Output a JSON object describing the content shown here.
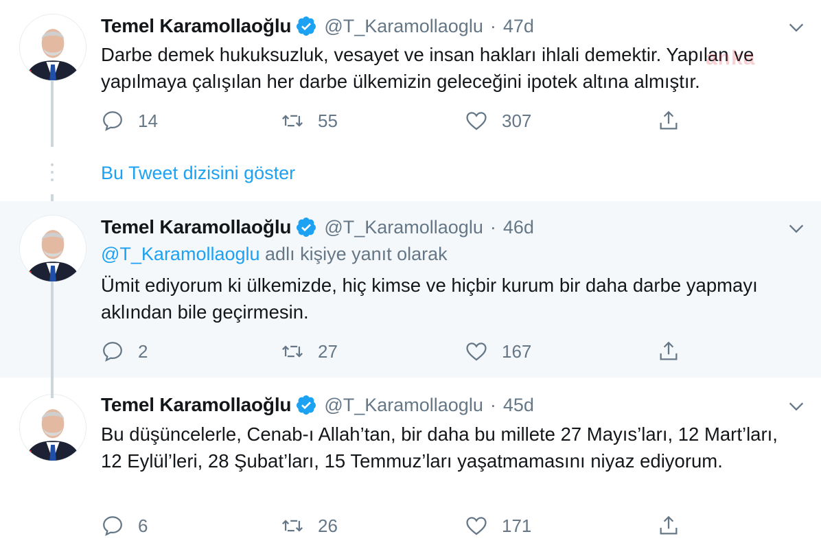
{
  "watermark": "anka",
  "show_thread": "Bu Tweet dizisini göster",
  "tweets": [
    {
      "name": "Temel Karamollaoğlu",
      "handle": "@T_Karamollaoglu",
      "separator": "·",
      "time": "47d",
      "text": "Darbe demek hukuksuzluk, vesayet ve insan hakları ihlali demektir. Yapılan ve yapılmaya çalışılan her darbe ülkemizin geleceğini ipotek altına almıştır.",
      "replies": "14",
      "retweets": "55",
      "likes": "307"
    },
    {
      "name": "Temel Karamollaoğlu",
      "handle": "@T_Karamollaoglu",
      "separator": "·",
      "time": "46d",
      "reply_to_handle": "@T_Karamollaoglu",
      "reply_to_suffix": " adlı kişiye yanıt olarak",
      "text": "Ümit ediyorum ki ülkemizde, hiç kimse ve hiçbir kurum bir daha darbe yapmayı aklından bile geçirmesin.",
      "replies": "2",
      "retweets": "27",
      "likes": "167"
    },
    {
      "name": "Temel Karamollaoğlu",
      "handle": "@T_Karamollaoglu",
      "separator": "·",
      "time": "45d",
      "text": "Bu düşüncelerle, Cenab-ı Allah’tan, bir daha bu millete 27 Mayıs’ları, 12 Mart’ları, 12 Eylül’leri, 28 Şubat’ları, 15 Temmuz’ları yaşatmamasını niyaz ediyorum.",
      "replies": "6",
      "retweets": "26",
      "likes": "171"
    }
  ],
  "icons": {
    "reply": "reply-icon",
    "retweet": "retweet-icon",
    "like": "heart-icon",
    "share": "share-icon",
    "verified": "verified-badge-icon",
    "more": "chevron-down-icon"
  },
  "colors": {
    "accent": "#1da1f2",
    "muted": "#657786",
    "text": "#14171a",
    "highlight_bg": "#f5f8fa",
    "thread_line": "#ccd6dd"
  }
}
